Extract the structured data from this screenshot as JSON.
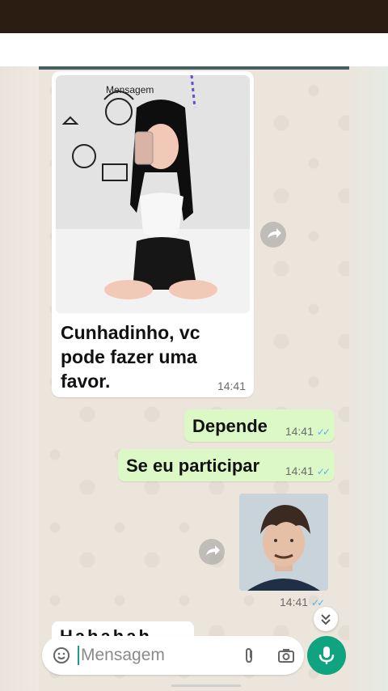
{
  "chat": {
    "incoming_message": {
      "text": "Cunhadinho, vc\npode fazer uma\nfavor.",
      "time": "14:41",
      "photo_sticker_text": "Mensagem"
    },
    "outgoing_messages": [
      {
        "text": "Depende",
        "time": "14:41"
      },
      {
        "text": "Se eu participar",
        "time": "14:41"
      }
    ],
    "outgoing_photo_time": "14:41",
    "partial_incoming_text": "Hahahah"
  },
  "composer": {
    "placeholder": "Mensagem"
  },
  "colors": {
    "outgoing_bubble": "#dcf8c6",
    "mic_button": "#0fa37f",
    "read_check": "#4fb6ec",
    "status_bar": "#2b1d12"
  }
}
